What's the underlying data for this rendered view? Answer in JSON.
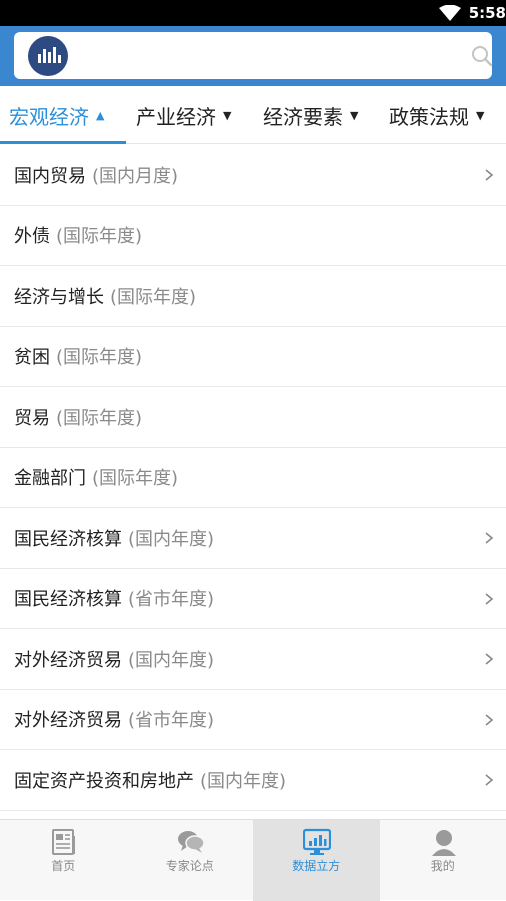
{
  "status_bar": {
    "time": "5:58"
  },
  "header": {
    "logo_icon": "chart-logo",
    "search_icon": "search-icon"
  },
  "tabs": [
    {
      "label": "宏观经济",
      "active": true
    },
    {
      "label": "产业经济",
      "active": false
    },
    {
      "label": "经济要素",
      "active": false
    },
    {
      "label": "政策法规",
      "active": false
    }
  ],
  "list": [
    {
      "title": "国内贸易",
      "sub": "(国内月度)",
      "chevron": true
    },
    {
      "title": "外债",
      "sub": "(国际年度)",
      "chevron": false
    },
    {
      "title": "经济与增长",
      "sub": "(国际年度)",
      "chevron": false
    },
    {
      "title": "贫困",
      "sub": "(国际年度)",
      "chevron": false
    },
    {
      "title": "贸易",
      "sub": "(国际年度)",
      "chevron": false
    },
    {
      "title": "金融部门",
      "sub": "(国际年度)",
      "chevron": false
    },
    {
      "title": "国民经济核算",
      "sub": "(国内年度)",
      "chevron": true
    },
    {
      "title": "国民经济核算",
      "sub": "(省市年度)",
      "chevron": true
    },
    {
      "title": "对外经济贸易",
      "sub": "(国内年度)",
      "chevron": true
    },
    {
      "title": "对外经济贸易",
      "sub": "(省市年度)",
      "chevron": true
    },
    {
      "title": "固定资产投资和房地产",
      "sub": "(国内年度)",
      "chevron": true
    }
  ],
  "bottom_nav": [
    {
      "label": "首页",
      "icon": "document-icon",
      "active": false
    },
    {
      "label": "专家论点",
      "icon": "chat-bubbles-icon",
      "active": false
    },
    {
      "label": "数据立方",
      "icon": "monitor-chart-icon",
      "active": true
    },
    {
      "label": "我的",
      "icon": "user-icon",
      "active": false
    }
  ],
  "colors": {
    "accent": "#2b90d9",
    "header": "#3a87d0",
    "logo": "#2d4a83"
  }
}
